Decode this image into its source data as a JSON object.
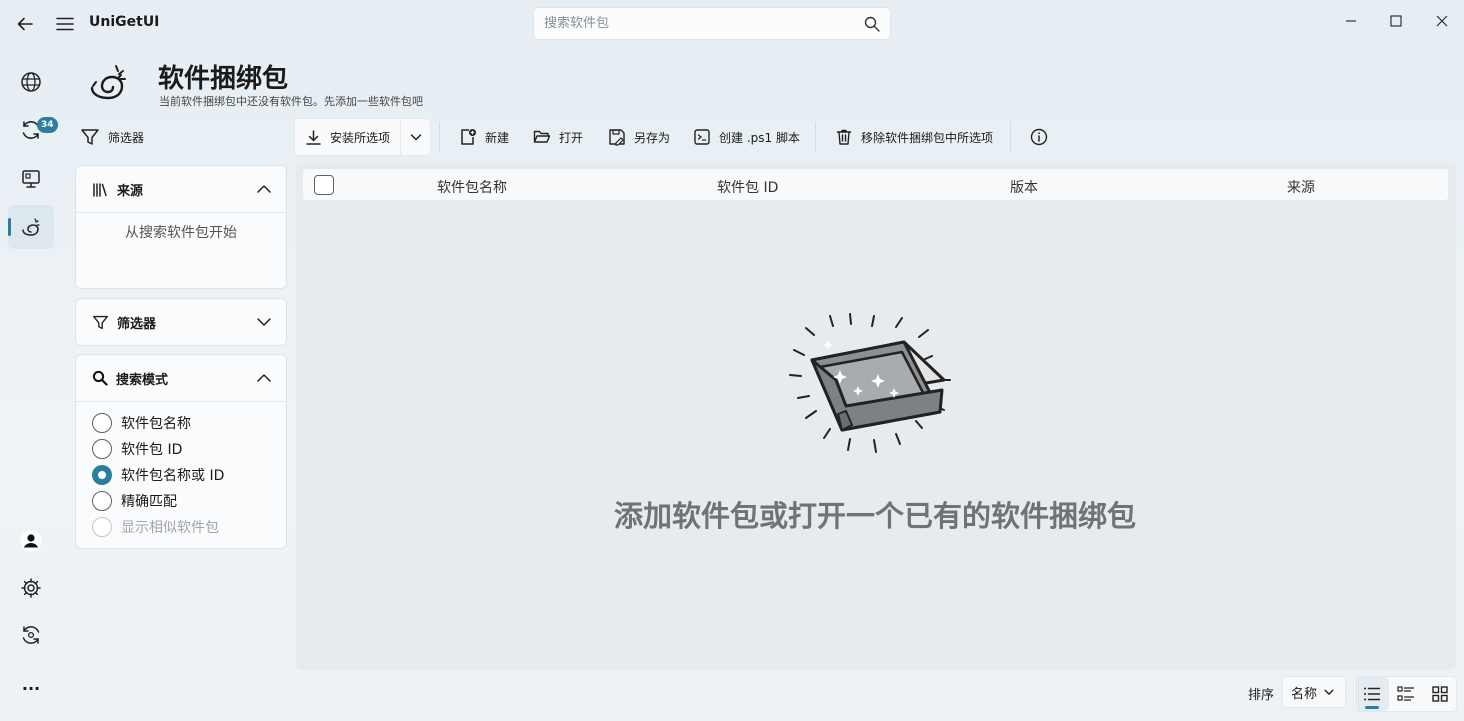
{
  "app": {
    "title": "UniGetUI",
    "search_placeholder": "搜索软件包"
  },
  "nav": {
    "updates_badge": "34",
    "more_label": "..."
  },
  "page": {
    "title": "软件捆绑包",
    "subtitle": "当前软件捆绑包中还没有软件包。先添加一些软件包吧"
  },
  "filters_toggle": "筛选器",
  "toolbar": {
    "install": "安装所选项",
    "new": "新建",
    "open": "打开",
    "save_as": "另存为",
    "create_ps1": "创建 .ps1 脚本",
    "remove": "移除软件捆绑包中所选项"
  },
  "sources_panel": {
    "title": "来源",
    "empty": "从搜索软件包开始"
  },
  "filters_panel": {
    "title": "筛选器"
  },
  "search_mode_panel": {
    "title": "搜索模式",
    "options": [
      {
        "label": "软件包名称",
        "checked": false,
        "disabled": false
      },
      {
        "label": "软件包 ID",
        "checked": false,
        "disabled": false
      },
      {
        "label": "软件包名称或 ID",
        "checked": true,
        "disabled": false
      },
      {
        "label": "精确匹配",
        "checked": false,
        "disabled": false
      },
      {
        "label": "显示相似软件包",
        "checked": false,
        "disabled": true
      }
    ]
  },
  "table": {
    "columns": [
      "软件包名称",
      "软件包 ID",
      "版本",
      "来源"
    ]
  },
  "empty_state": "添加软件包或打开一个已有的软件捆绑包",
  "footer": {
    "sort_label": "排序",
    "sort_value": "名称"
  },
  "colors": {
    "accent": "#2a7f9e"
  }
}
